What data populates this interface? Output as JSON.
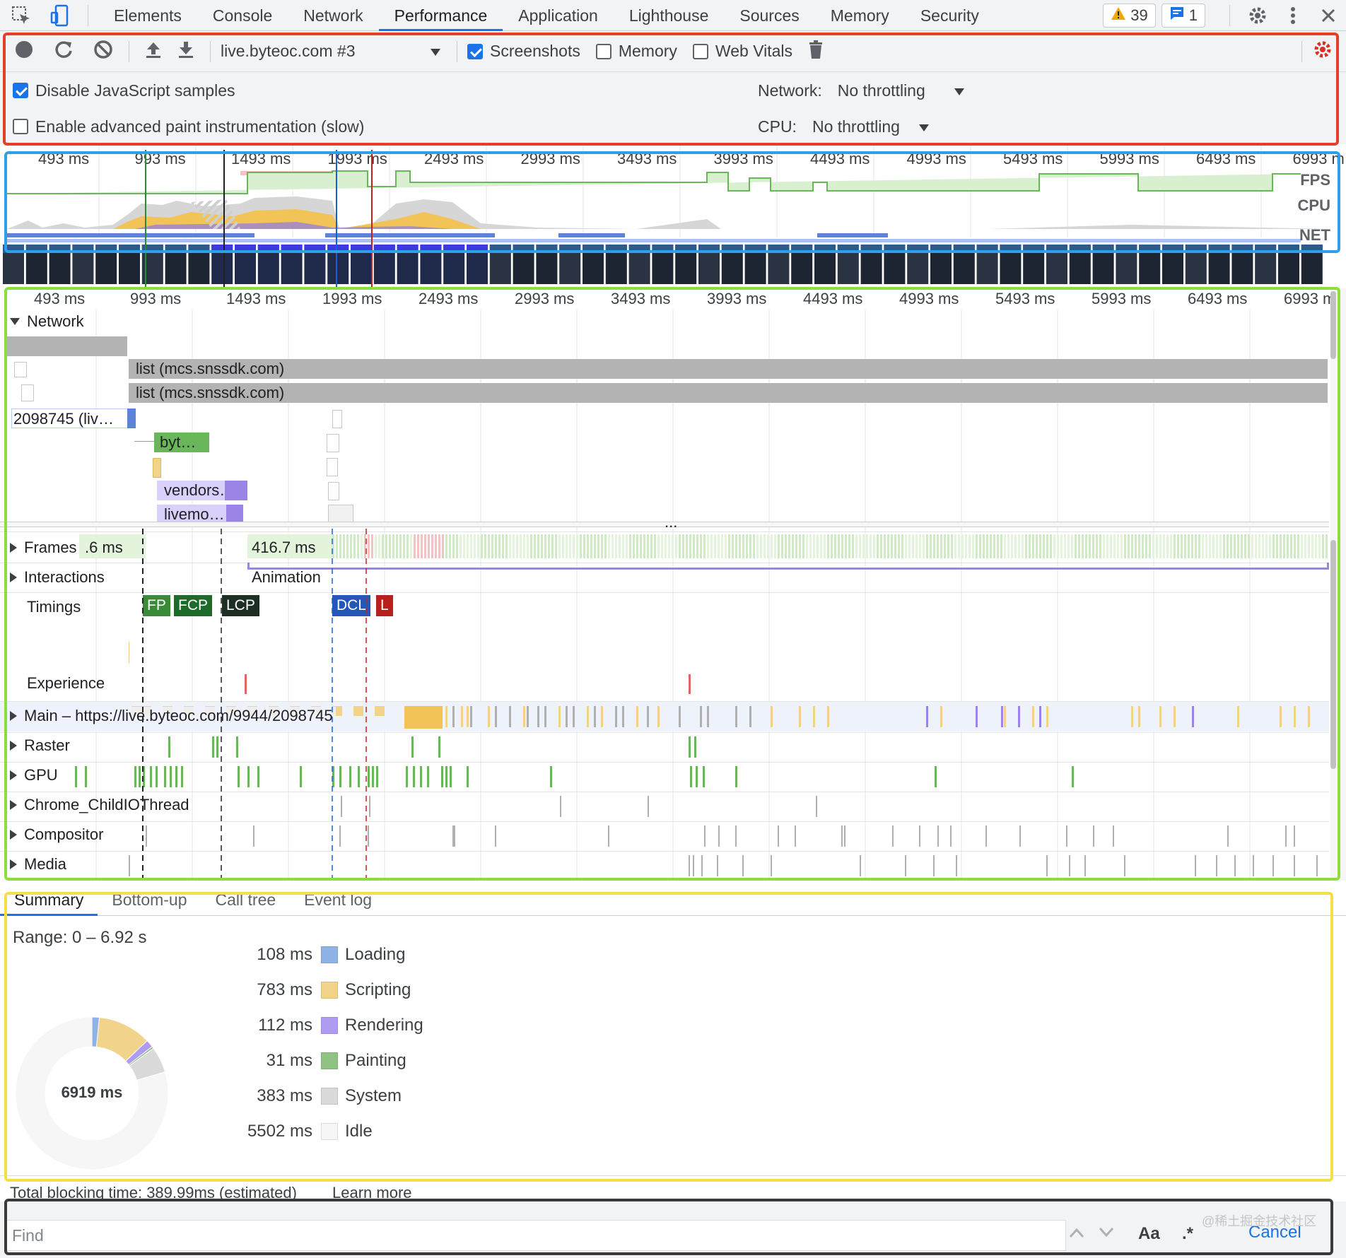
{
  "tabbar": {
    "tabs": [
      "Elements",
      "Console",
      "Network",
      "Performance",
      "Application",
      "Lighthouse",
      "Sources",
      "Memory",
      "Security"
    ],
    "active_index": 3,
    "warnings": "39",
    "messages": "1"
  },
  "toolbar": {
    "profile": "live.byteoc.com #3",
    "screenshots_label": "Screenshots",
    "memory_label": "Memory",
    "web_vitals_label": "Web Vitals",
    "disable_js_label": "Disable JavaScript samples",
    "advanced_paint_label": "Enable advanced paint instrumentation (slow)",
    "network_label": "Network:",
    "network_value": "No throttling",
    "cpu_label": "CPU:",
    "cpu_value": "No throttling",
    "screenshots_checked": true,
    "memory_checked": false,
    "web_vitals_checked": false,
    "disable_js_checked": true,
    "advanced_paint_checked": false
  },
  "overview": {
    "ticks": [
      "493 ms",
      "993 ms",
      "1493 ms",
      "1993 ms",
      "2493 ms",
      "2993 ms",
      "3493 ms",
      "3993 ms",
      "4493 ms",
      "4993 ms",
      "5493 ms",
      "5993 ms",
      "6493 ms",
      "6993 m"
    ],
    "fps_label": "FPS",
    "cpu_label": "CPU",
    "net_label": "NET"
  },
  "timeline": {
    "ticks": [
      "493 ms",
      "993 ms",
      "1493 ms",
      "1993 ms",
      "2493 ms",
      "2993 ms",
      "3493 ms",
      "3993 ms",
      "4493 ms",
      "4993 ms",
      "5493 ms",
      "5993 ms",
      "6493 ms",
      "6993 m"
    ],
    "network_label": "Network",
    "requests": [
      "list (mcs.snssdk.com)",
      "list (mcs.snssdk.com)",
      "2098745 (liv…",
      "byt…",
      "vendors…",
      "livemo…"
    ],
    "more": "...",
    "frames_label": "Frames",
    "frame_time_a": ".6 ms",
    "frame_time_b": "416.7 ms",
    "interactions_label": "Interactions",
    "animation_label": "Animation",
    "timings_label": "Timings",
    "markers": [
      "FP",
      "FCP",
      "LCP",
      "DCL",
      "L"
    ],
    "experience_label": "Experience",
    "main_label": "Main – https://live.byteoc.com/9944/2098745",
    "raster_label": "Raster",
    "gpu_label": "GPU",
    "childio_label": "Chrome_ChildIOThread",
    "compositor_label": "Compositor",
    "media_label": "Media"
  },
  "summary": {
    "tabs": [
      "Summary",
      "Bottom-up",
      "Call tree",
      "Event log"
    ],
    "range": "Range: 0 – 6.92 s",
    "total": "6919 ms",
    "rows": [
      {
        "ms": "108 ms",
        "label": "Loading",
        "color": "#8fb3e6",
        "value": 108
      },
      {
        "ms": "783 ms",
        "label": "Scripting",
        "color": "#f2d38b",
        "value": 783
      },
      {
        "ms": "112 ms",
        "label": "Rendering",
        "color": "#af9cf0",
        "value": 112
      },
      {
        "ms": "31 ms",
        "label": "Painting",
        "color": "#8ec384",
        "value": 31
      },
      {
        "ms": "383 ms",
        "label": "System",
        "color": "#dadada",
        "value": 383
      },
      {
        "ms": "5502 ms",
        "label": "Idle",
        "color": "#f6f6f6",
        "value": 5502
      }
    ],
    "tbt": "Total blocking time: 389.99ms (estimated)",
    "learn_more": "Learn more"
  },
  "findbar": {
    "placeholder": "Find",
    "match_case": "Aa",
    "regex": ".*",
    "cancel": "Cancel",
    "watermark": "@稀土掘金技术社区"
  }
}
